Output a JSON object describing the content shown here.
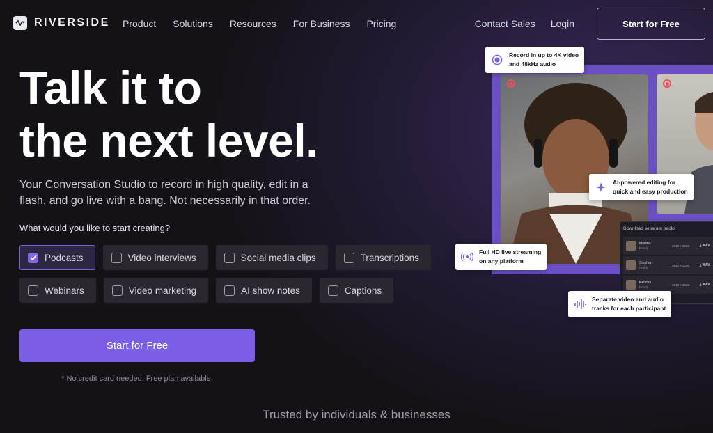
{
  "nav": {
    "logo_text": "RIVERSIDE",
    "links": [
      "Product",
      "Solutions",
      "Resources",
      "For Business",
      "Pricing"
    ],
    "contact_sales": "Contact Sales",
    "login": "Login",
    "cta": "Start for Free"
  },
  "hero": {
    "headline_line1": "Talk it to",
    "headline_line2": "the next level.",
    "subtitle": "Your Conversation Studio to record in high quality, edit in a flash, and go live with a bang. Not necessarily in that order.",
    "question": "What would you like to start creating?",
    "options_row1": [
      {
        "label": "Podcasts",
        "checked": true
      },
      {
        "label": "Video interviews",
        "checked": false
      },
      {
        "label": "Social media clips",
        "checked": false
      },
      {
        "label": "Transcriptions",
        "checked": false
      }
    ],
    "options_row2": [
      {
        "label": "Webinars",
        "checked": false
      },
      {
        "label": "Video marketing",
        "checked": false
      },
      {
        "label": "AI show notes",
        "checked": false
      },
      {
        "label": "Captions",
        "checked": false
      }
    ],
    "cta": "Start for Free",
    "note": "* No credit card needed. Free plan available."
  },
  "trusted": "Trusted by individuals & businesses",
  "visual": {
    "tip_record": [
      "Record in up to 4K video",
      "and 48kHz audio"
    ],
    "tip_ai": [
      "AI-powered editing for",
      "quick and easy production"
    ],
    "tip_live": [
      "Full HD live streaming",
      "on any platform"
    ],
    "tip_tracks": [
      "Separate video and audio",
      "tracks for each participant"
    ],
    "panel_title": "Download separate tracks",
    "tracks": [
      {
        "name": "Marsha",
        "status": "Ready",
        "res": "3840 × 2160",
        "dl": "WAV"
      },
      {
        "name": "Stephen",
        "status": "Ready",
        "res": "3840 × 2160",
        "dl": "WAV"
      },
      {
        "name": "Kendall",
        "status": "Ready",
        "res": "3840 × 2160",
        "dl": "WAV"
      }
    ]
  },
  "colors": {
    "accent": "#7c5fe6",
    "frame": "#6b4fc4",
    "record": "#e8505b"
  }
}
